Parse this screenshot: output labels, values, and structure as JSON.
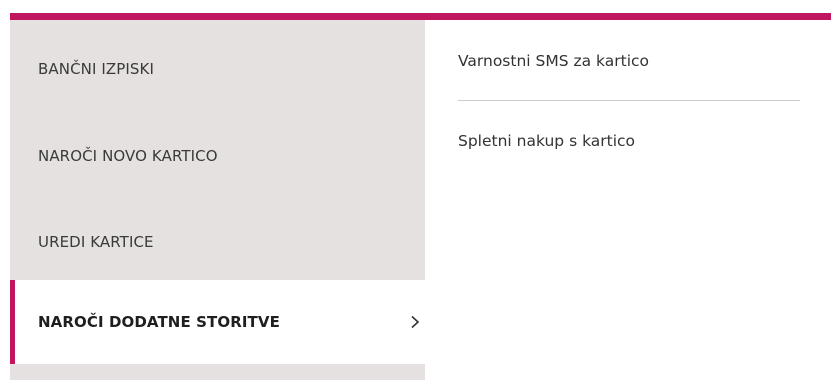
{
  "accent_color": "#c0155f",
  "sidebar": {
    "items": [
      {
        "label": "BANČNI IZPISKI"
      },
      {
        "label": "NAROČI NOVO KARTICO"
      },
      {
        "label": "UREDI KARTICE"
      },
      {
        "label": "NAROČI DODATNE STORITVE",
        "active": true,
        "icon": "chevron-right-icon"
      }
    ]
  },
  "submenu": {
    "links": [
      {
        "label": "Varnostni SMS za kartico"
      },
      {
        "label": "Spletni nakup s kartico"
      }
    ]
  }
}
